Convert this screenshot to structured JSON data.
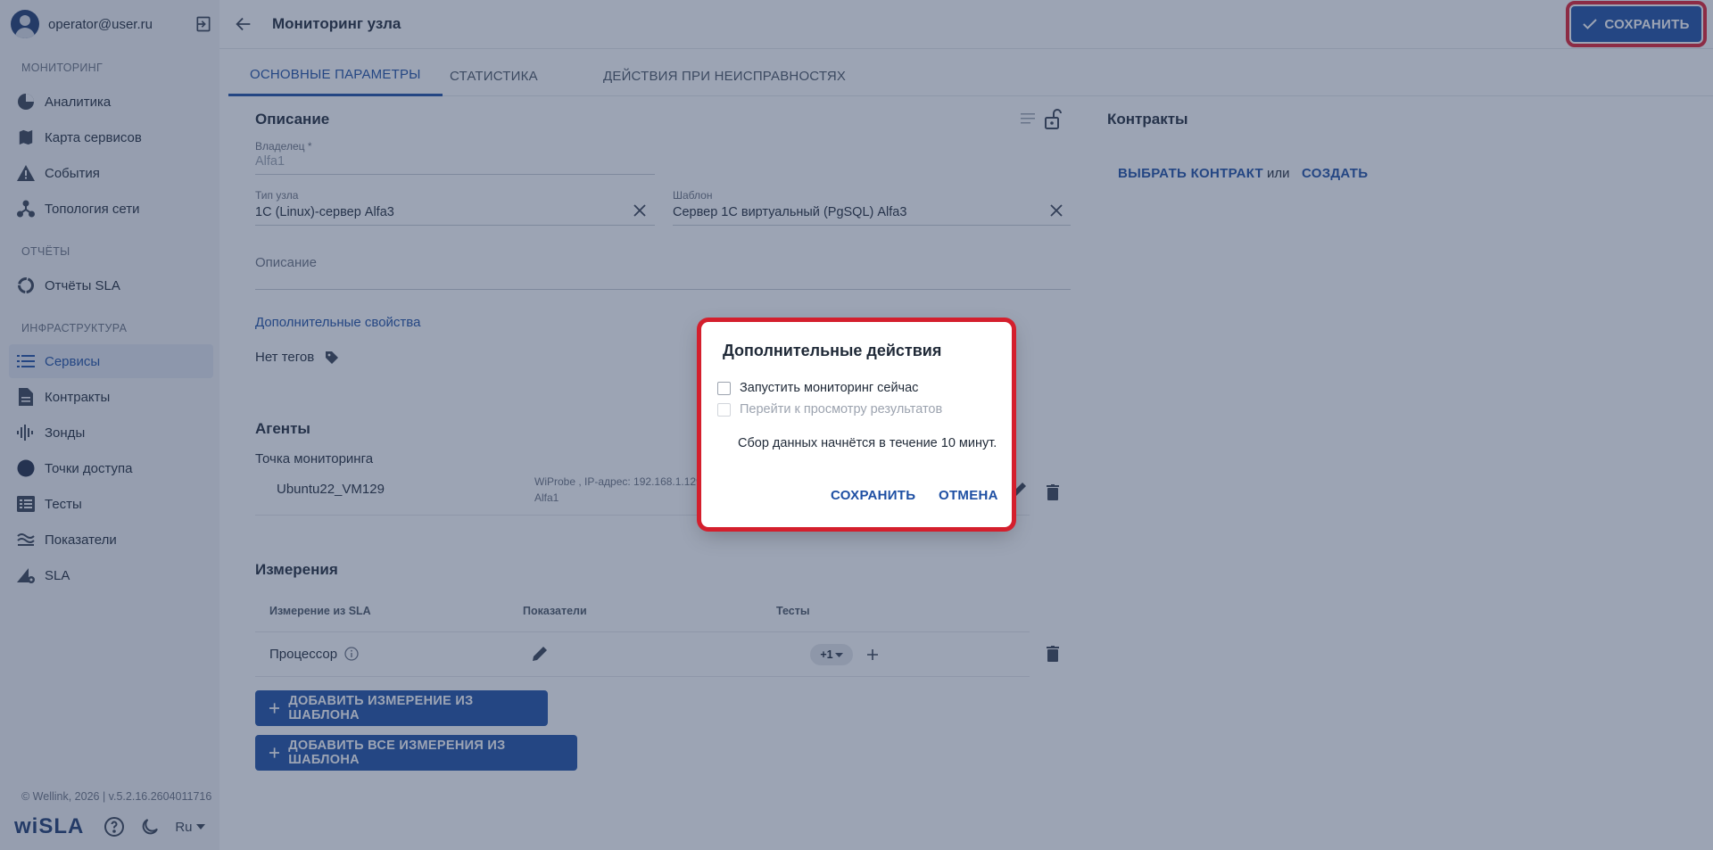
{
  "user": {
    "email": "operator@user.ru"
  },
  "sidebar": {
    "sections": [
      {
        "title": "МОНИТОРИНГ",
        "items": [
          {
            "label": "Аналитика",
            "icon": "pie-chart-icon"
          },
          {
            "label": "Карта сервисов",
            "icon": "map-icon"
          },
          {
            "label": "События",
            "icon": "warning-icon"
          },
          {
            "label": "Топология сети",
            "icon": "topology-icon"
          }
        ]
      },
      {
        "title": "ОТЧЁТЫ",
        "items": [
          {
            "label": "Отчёты SLA",
            "icon": "report-ring-icon"
          }
        ]
      },
      {
        "title": "ИНФРАСТРУКТУРА",
        "items": [
          {
            "label": "Сервисы",
            "icon": "list-icon",
            "active": true
          },
          {
            "label": "Контракты",
            "icon": "document-icon"
          },
          {
            "label": "Зонды",
            "icon": "probe-icon"
          },
          {
            "label": "Точки доступа",
            "icon": "access-point-icon"
          },
          {
            "label": "Тесты",
            "icon": "tests-icon"
          },
          {
            "label": "Показатели",
            "icon": "metrics-icon"
          },
          {
            "label": "SLA",
            "icon": "sla-settings-icon"
          }
        ]
      }
    ],
    "copyright": "© Wellink, 2026 | v.5.2.16.2604011716",
    "logo": "wiSLA",
    "language": "Ru"
  },
  "header": {
    "title": "Мониторинг узла",
    "save_label": "СОХРАНИТЬ"
  },
  "tabs": [
    {
      "label": "ОСНОВНЫЕ ПАРАМЕТРЫ",
      "active": true
    },
    {
      "label": "СТАТИСТИКА"
    },
    {
      "label": "ДЕЙСТВИЯ ПРИ НЕИСПРАВНОСТЯХ"
    }
  ],
  "description": {
    "title": "Описание",
    "owner_label": "Владелец *",
    "owner_value": "Alfa1",
    "node_type_label": "Тип узла",
    "node_type_value": "1С (Linux)-сервер Alfa3",
    "template_label": "Шаблон",
    "template_value": "Сервер 1С виртуальный (PgSQL) Alfa3",
    "description_placeholder": "Описание",
    "extra_props_link": "Дополнительные свойства",
    "tags_text": "Нет тегов"
  },
  "contracts": {
    "title": "Контракты",
    "select_label": "ВЫБРАТЬ КОНТРАКТ",
    "or_text": "или",
    "create_label": "СОЗДАТЬ"
  },
  "agents": {
    "title": "Агенты",
    "point_label": "Точка мониторинга",
    "agent_name": "Ubuntu22_VM129",
    "agent_info_line1": "WiProbe , IP-адрес: 192.168.1.129",
    "agent_info_line2": "Alfa1"
  },
  "measurements": {
    "title": "Измерения",
    "columns": [
      "Измерение из SLA",
      "Показатели",
      "Тесты"
    ],
    "rows": [
      {
        "name": "Процессор",
        "tests_badge": "+1"
      }
    ],
    "add_from_template": "ДОБАВИТЬ ИЗМЕРЕНИЕ ИЗ ШАБЛОНА",
    "add_all_from_template": "ДОБАВИТЬ ВСЕ ИЗМЕРЕНИЯ ИЗ ШАБЛОНА"
  },
  "dialog": {
    "title": "Дополнительные действия",
    "checkbox_start": "Запустить мониторинг сейчас",
    "checkbox_view": "Перейти к просмотру результатов",
    "note": "Сбор данных начнётся в течение 10 минут.",
    "save_label": "СОХРАНИТЬ",
    "cancel_label": "ОТМЕНА"
  },
  "colors": {
    "accent": "#1e4fa3",
    "highlight": "#e11d2e",
    "overlay": "#2c3e60"
  }
}
